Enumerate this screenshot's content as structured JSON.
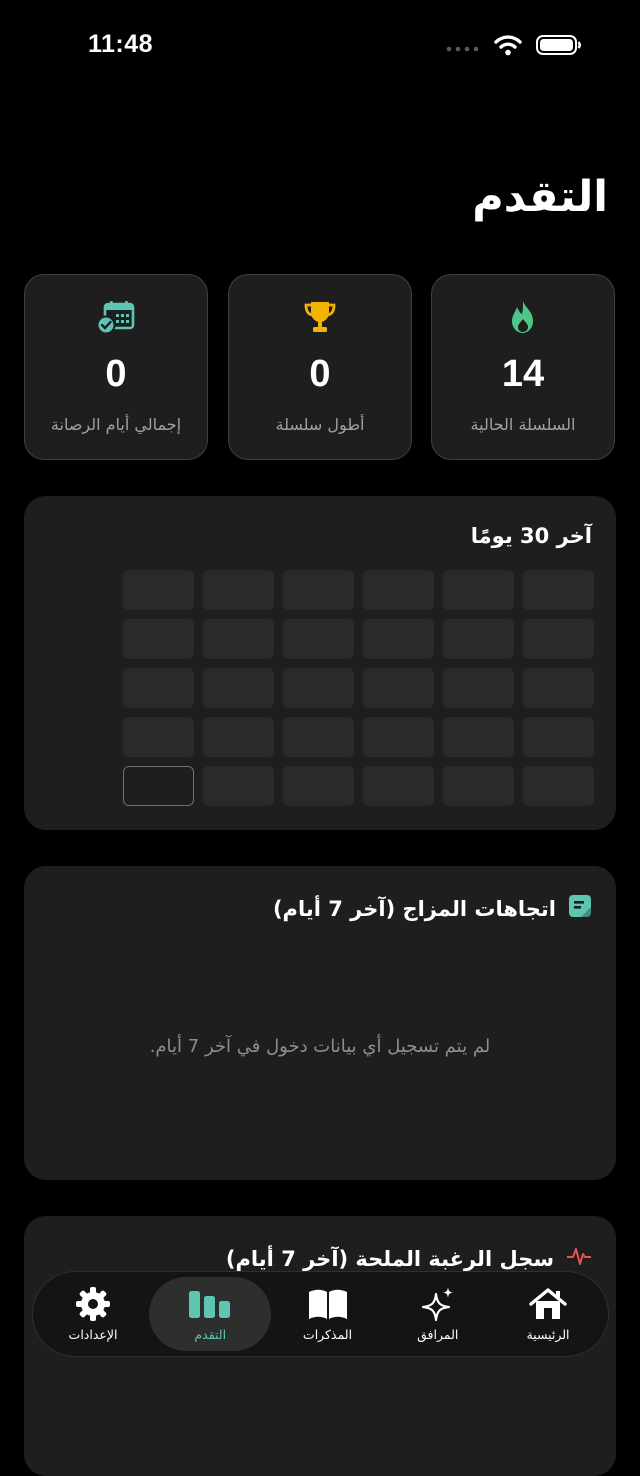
{
  "status_bar": {
    "time": "11:48"
  },
  "page": {
    "title": "التقدم"
  },
  "stats": [
    {
      "value": "14",
      "label": "السلسلة الحالية",
      "icon": "flame-icon"
    },
    {
      "value": "0",
      "label": "أطول سلسلة",
      "icon": "trophy-icon"
    },
    {
      "value": "0",
      "label": "إجمالي أيام الرصانة",
      "icon": "calendar-check-icon"
    }
  ],
  "last30": {
    "title": "آخر 30 يومًا"
  },
  "mood": {
    "title": "اتجاهات المزاج (آخر 7 أيام)",
    "empty_message": "لم يتم تسجيل أي بيانات دخول في آخر 7 أيام."
  },
  "craving": {
    "title": "سجل الرغبة الملحة (آخر 7 أيام)"
  },
  "tabs": [
    {
      "label": "الرئيسية",
      "icon": "home-icon"
    },
    {
      "label": "المرافق",
      "icon": "sparkles-icon"
    },
    {
      "label": "المذكرات",
      "icon": "book-icon"
    },
    {
      "label": "التقدم",
      "icon": "chart-bars-icon"
    },
    {
      "label": "الإعدادات",
      "icon": "gear-icon"
    }
  ],
  "colors": {
    "accent": "#5cc6b2",
    "flame": "#4fc58a",
    "trophy": "#f2b400",
    "craving": "#e25555",
    "background": "#000000",
    "card": "#1e1e1f"
  }
}
